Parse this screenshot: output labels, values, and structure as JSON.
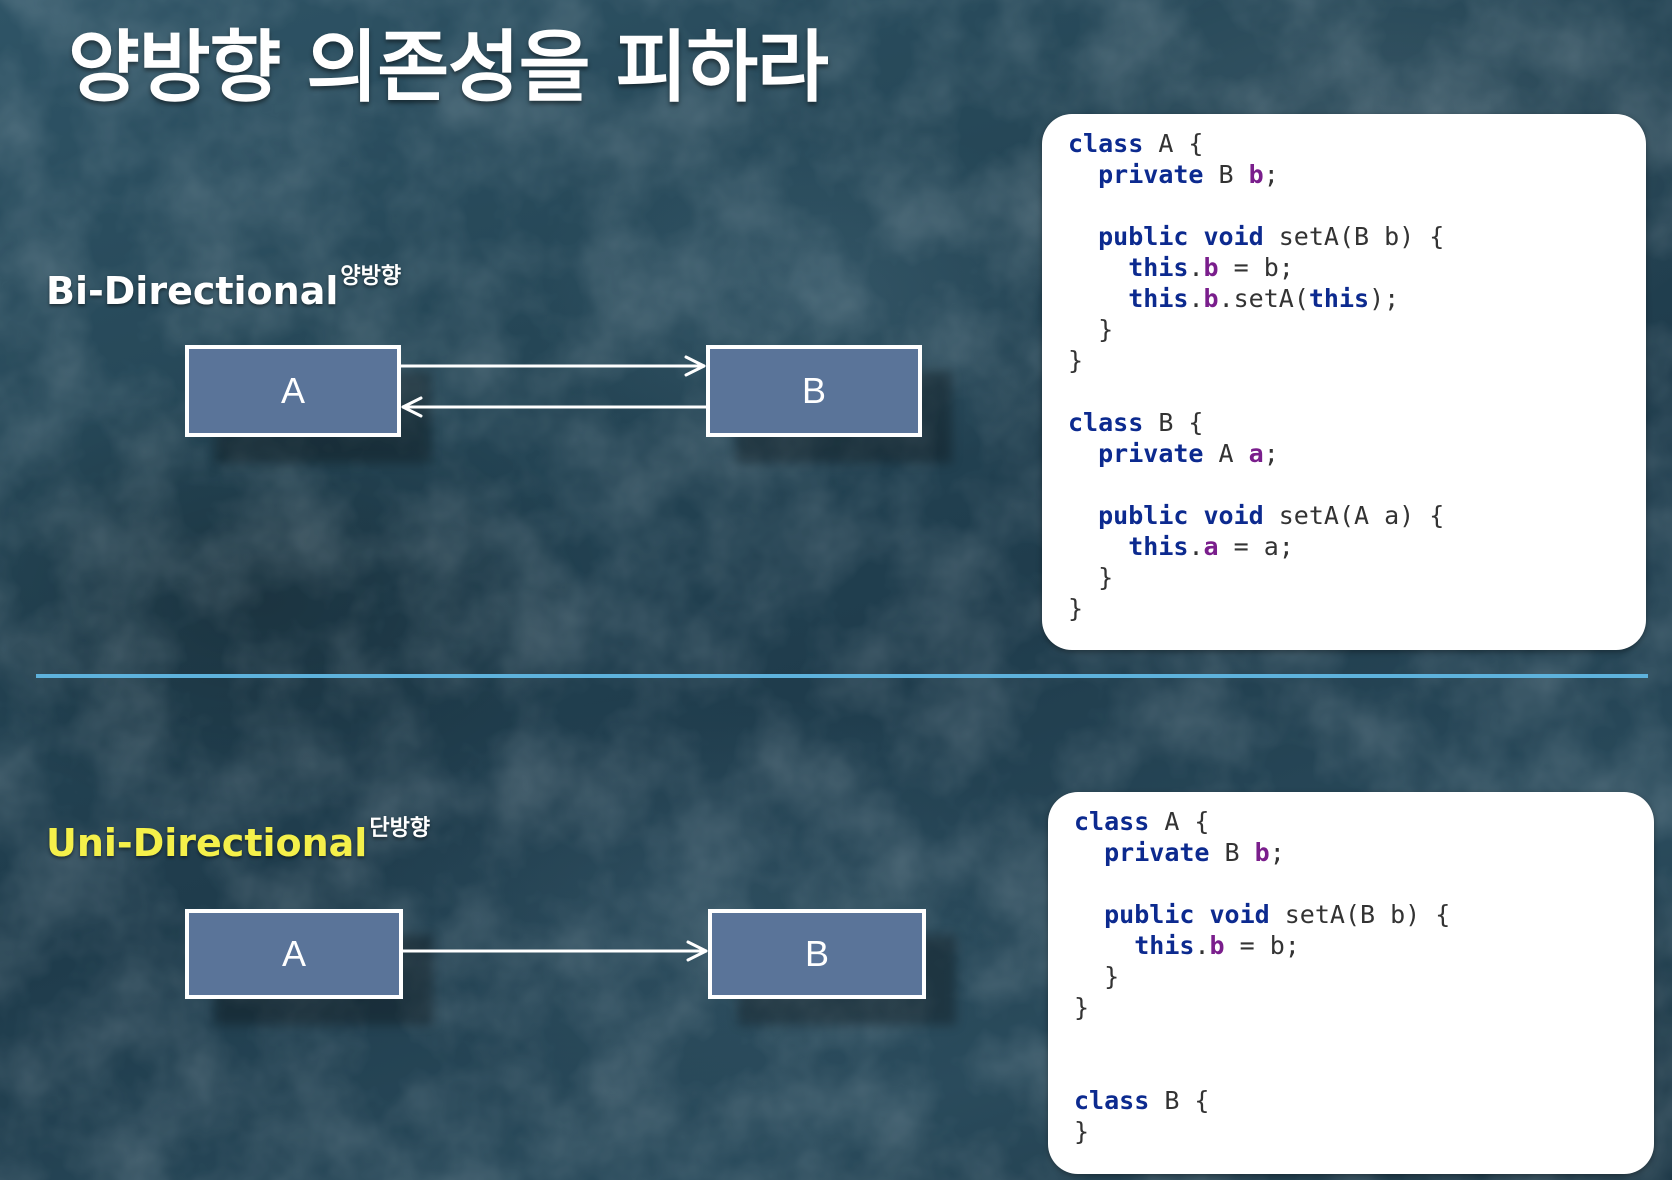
{
  "title": "양방향 의존성을 피하라",
  "colors": {
    "divider": "#5eb2dc",
    "box_fill": "#5a7499",
    "uni_label": "#f5f04a",
    "keyword": "#0c2a8f",
    "field": "#7a1e8c"
  },
  "bi_directional": {
    "label": "Bi-Directional",
    "label_sup": "양방향",
    "box_a": "A",
    "box_b": "B",
    "code": [
      [
        [
          "kw",
          "class"
        ],
        [
          "plain",
          " A {"
        ]
      ],
      [
        [
          "plain",
          "  "
        ],
        [
          "kw",
          "private"
        ],
        [
          "plain",
          " B "
        ],
        [
          "field",
          "b"
        ],
        [
          "plain",
          ";"
        ]
      ],
      [],
      [
        [
          "plain",
          "  "
        ],
        [
          "kw",
          "public"
        ],
        [
          "plain",
          " "
        ],
        [
          "kw",
          "void"
        ],
        [
          "plain",
          " setA(B b) {"
        ]
      ],
      [
        [
          "plain",
          "    "
        ],
        [
          "kw",
          "this"
        ],
        [
          "plain",
          "."
        ],
        [
          "field",
          "b"
        ],
        [
          "plain",
          " = b;"
        ]
      ],
      [
        [
          "plain",
          "    "
        ],
        [
          "kw",
          "this"
        ],
        [
          "plain",
          "."
        ],
        [
          "field",
          "b"
        ],
        [
          "plain",
          ".setA("
        ],
        [
          "kw",
          "this"
        ],
        [
          "plain",
          ");"
        ]
      ],
      [
        [
          "plain",
          "  }"
        ]
      ],
      [
        [
          "plain",
          "}"
        ]
      ],
      [],
      [
        [
          "kw",
          "class"
        ],
        [
          "plain",
          " B {"
        ]
      ],
      [
        [
          "plain",
          "  "
        ],
        [
          "kw",
          "private"
        ],
        [
          "plain",
          " A "
        ],
        [
          "field",
          "a"
        ],
        [
          "plain",
          ";"
        ]
      ],
      [],
      [
        [
          "plain",
          "  "
        ],
        [
          "kw",
          "public"
        ],
        [
          "plain",
          " "
        ],
        [
          "kw",
          "void"
        ],
        [
          "plain",
          " setA(A a) {"
        ]
      ],
      [
        [
          "plain",
          "    "
        ],
        [
          "kw",
          "this"
        ],
        [
          "plain",
          "."
        ],
        [
          "field",
          "a"
        ],
        [
          "plain",
          " = a;"
        ]
      ],
      [
        [
          "plain",
          "  }"
        ]
      ],
      [
        [
          "plain",
          "}"
        ]
      ]
    ]
  },
  "uni_directional": {
    "label": "Uni-Directional",
    "label_sup": "단방향",
    "box_a": "A",
    "box_b": "B",
    "code": [
      [
        [
          "kw",
          "class"
        ],
        [
          "plain",
          " A {"
        ]
      ],
      [
        [
          "plain",
          "  "
        ],
        [
          "kw",
          "private"
        ],
        [
          "plain",
          " B "
        ],
        [
          "field",
          "b"
        ],
        [
          "plain",
          ";"
        ]
      ],
      [],
      [
        [
          "plain",
          "  "
        ],
        [
          "kw",
          "public"
        ],
        [
          "plain",
          " "
        ],
        [
          "kw",
          "void"
        ],
        [
          "plain",
          " setA(B b) {"
        ]
      ],
      [
        [
          "plain",
          "    "
        ],
        [
          "kw",
          "this"
        ],
        [
          "plain",
          "."
        ],
        [
          "field",
          "b"
        ],
        [
          "plain",
          " = b;"
        ]
      ],
      [
        [
          "plain",
          "  }"
        ]
      ],
      [
        [
          "plain",
          "}"
        ]
      ],
      [],
      [],
      [
        [
          "kw",
          "class"
        ],
        [
          "plain",
          " B {"
        ]
      ],
      [
        [
          "plain",
          "}"
        ]
      ]
    ]
  }
}
